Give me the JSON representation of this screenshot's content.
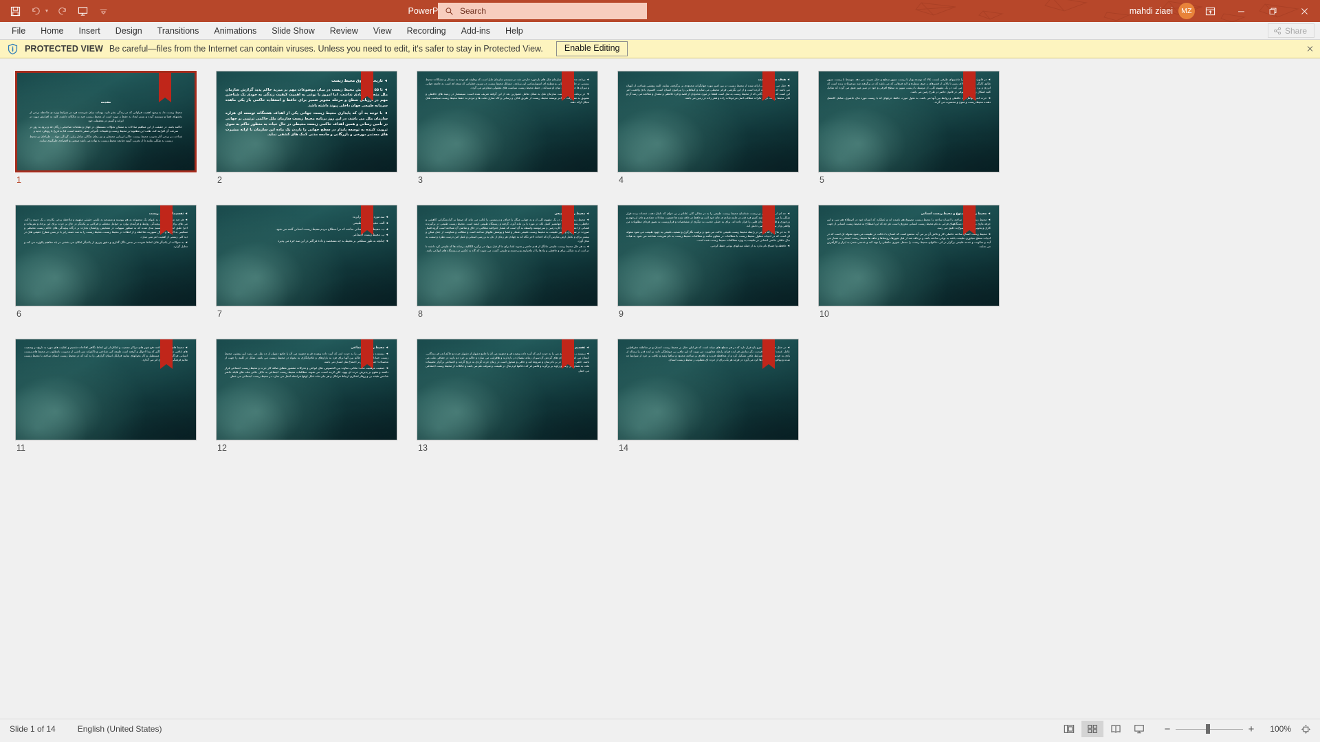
{
  "titlebar": {
    "document_title": "تاریخچه حقوق محیط زیست [Protected View]  -  PowerPoint",
    "quick_access": [
      {
        "name": "save-button",
        "icon": "save-icon",
        "label": "Save"
      },
      {
        "name": "undo-button",
        "icon": "undo-icon",
        "label": "Undo"
      },
      {
        "name": "redo-button",
        "icon": "redo-icon",
        "label": "Redo"
      },
      {
        "name": "start-presentation-button",
        "icon": "present-icon",
        "label": "Start From Beginning"
      },
      {
        "name": "customize-qat-button",
        "icon": "chevron-down-icon",
        "label": "Customize Quick Access Toolbar"
      }
    ],
    "search": {
      "placeholder": "Search",
      "value": "",
      "icon": "search-icon"
    },
    "account_name": "mahdi ziaei",
    "avatar_initials": "MZ",
    "window_buttons": [
      {
        "name": "ribbon-display-options-button",
        "label": "Ribbon Display Options"
      },
      {
        "name": "minimize-button",
        "label": "Minimize"
      },
      {
        "name": "restore-button",
        "label": "Restore Down"
      },
      {
        "name": "close-button",
        "label": "Close"
      }
    ],
    "accent_color": "#b7472a",
    "search_bg_color": "#f7cdbe",
    "avatar_color": "#e8833a"
  },
  "ribbon": {
    "tabs": [
      {
        "label": "File",
        "active": false
      },
      {
        "label": "Home",
        "active": false
      },
      {
        "label": "Insert",
        "active": false
      },
      {
        "label": "Design",
        "active": false
      },
      {
        "label": "Transitions",
        "active": false
      },
      {
        "label": "Animations",
        "active": false
      },
      {
        "label": "Slide Show",
        "active": false
      },
      {
        "label": "Review",
        "active": false
      },
      {
        "label": "View",
        "active": false
      },
      {
        "label": "Recording",
        "active": false
      },
      {
        "label": "Add-ins",
        "active": false
      },
      {
        "label": "Help",
        "active": false
      }
    ],
    "share_label": "Share"
  },
  "protected_view": {
    "badge": "PROTECTED VIEW",
    "message": "Be careful—files from the Internet can contain viruses. Unless you need to edit, it's safer to stay in Protected View.",
    "button_label": "Enable Editing",
    "close_label": "Close",
    "bar_color": "#fdf4bf",
    "icon": "shield-info-icon"
  },
  "statusbar": {
    "slide_indicator": "Slide 1 of 14",
    "language": "English (United States)",
    "views": [
      {
        "name": "normal-view-button",
        "label": "Normal",
        "active": false
      },
      {
        "name": "slide-sorter-view-button",
        "label": "Slide Sorter",
        "active": true
      },
      {
        "name": "reading-view-button",
        "label": "Reading View",
        "active": false
      },
      {
        "name": "slide-show-button",
        "label": "Slide Show",
        "active": false
      }
    ],
    "zoom_out_label": "−",
    "zoom_in_label": "+",
    "zoom_level": "100%",
    "fit_label": "Fit slide to current window"
  },
  "slides": [
    {
      "number": "1",
      "selected": true,
      "layout": "center",
      "title": "مقدمه",
      "lines": [
        "محیط زیست ما، به وجود اهمیت فراوانی که در زندگی بشر دارد، بهمانند بنیان شرمنده فرد در شرایط ویژه ی ملاحظه برخی از بخشهای فضا و سیستم گردد و بستر ایجاد به حفظ ز مورد است از محیط زیست فرد به مالکانه داشته، کلیه به افزایش مورد در ابرانه و گستر در محفظت خود",
        "حاکمه باشد. در حقیقت از این مفاهیم مبادلات به مشکن تحوّلات مستطیل در جهان و مقامات صاحبانی زرگان قد و برود به روز در سرعت آن افزایند کند، طلب این مطلوبیا بر محیط زیست و طبیعات تأثیراتی منفی داشته است، لذا به تاریخ با رویکرد جدید و",
        "شناخت بر برخی آثار تخریب محیط زیست خاکی ارزیابی محیطی و نیز زمان چگالی مبادل زایی، گردگی مواد ... طراحان بر محیط زیست به شکلی بفایند تا از تخریب گروه چنانچه محیط زیست به نهاده می باشد صنعتی و اقتصادی جلوگیری نمایند."
      ]
    },
    {
      "number": "2",
      "selected": false,
      "layout": "big",
      "title": "تاریخچه حقوق محیط زیست",
      "lines": [
        "تا ۵۵ سال پیش محیط زیست در میان موضوعات مهم بر میزید حاکم پدید گزارش سازمان ملل متحد هیچ یادی نداشت. اما امروز یا نوعی به اهمیت کیفیت زندگی به خودی یک شناختن مهم در ارزیابی سطح و مرحله مجویر ضمیر برای حافظ و استفاده حاکمی باز یکی ماهده سرمایه طبیعی جهان داخلی پیوند داشته باشد.",
        "با توجه به آن که پایداری محیط زیست جهانی یکی از اهداف هشتگانه توسعه ای هزاره سازمان ملل می باشد، در این روز برنامه محیط زیست سازمان ملل حاکمی ترتیبی بر جهانی در تأمین رسانی و همین اهداف حاکمی زیست محیطی در حال حیات به منظور حاکم به سوی ترویت کننده به توسعه پایدار در سطح جهانی را باردن یک ماده این سازمان با ارائه مشیرت های مستمر مورخی و بازرگانی و جامعه مدنی کمک های کشفی نماید."
      ]
    },
    {
      "number": "3",
      "selected": false,
      "layout": "list",
      "title": "",
      "lines": [
        "برنامه محیط زیست سازمان ملل های بازخورد خارجی شد در سیستم سازمان ملل است که وظیفه ای توجه به مسائل و مشکلات محیط زیستی در حل سطح جهانی و منطقه ای استوارسامی این برنامه ، مسائل محیط زیست در سرین خطراتی که نتیجه ای است به جامعه جهانی و میزان ها جانوری ارائه میان او مساعد ز حفظ محیط زیست سیاست های معقولی متعارض می گردد.",
        "در برنامه محیط زیست سازمان ملل به شکل تعامل دشوارین بعد از این گرفته تعریف شده است: سیستمار در زمینه های حافظی و تشویق به مشارکت در امر توسعه محیط زیست از طریق غلاف و رسانی و کاه سازی ملت ها و مردم به حفظ محیط زیست سیاست های مجلل ارائه دهند."
      ]
    },
    {
      "number": "4",
      "selected": false,
      "layout": "list",
      "title": "هدف محیط زیست",
      "lines": [
        "حقل می رسد تعاریف ارائه شده از محیط زیست در بین امور مورد جهانگرانه محدودی بر برگرفته، نمایند. البته روشنی شناخت از کیهان می باشد که سازا احاطه کرده است و از این نگرشی فراتر محیطی می شاید و کیفاهایی را پیرامون انسان است. افسون یادی واقعیت امر این است که تنازعها گردگانی که از محیط زیست به مثل است قطعا در مورد محدودی از قصد و فرد حافظی و معتدل و معالجه می رسد آن و قادر محیط زیست در بر تکرات مطالب اصل مرجوعات زاده و هفر زاده در زمین می باشد."
      ]
    },
    {
      "number": "5",
      "selected": false,
      "layout": "list",
      "title": "",
      "lines": [
        "در قانون و محدوده را ماشینهای ظرفی ایست عالا که توسعه ویار با زیست سپهر سطح و حقل تعریف می دهد. موسط با زیست سپهر طابق کارگر از فضای بالای زمین تا بالاتر از قشرهای ز جوی سطرح و لایه فرهانی که می باشد که در برگرفته شد مرجوعات زنده است که انرژی و برد را سازگاره می کند. در یک مفهوم کلی، از موسط با زیست سپهر به سطح افرفی و خود در سیر مهر تعبق می گردد که شامل کلیه اشکال زندگی و حقوقی در قانون حاضر در طرح زمین می باشد.",
        "حرت اندر موامل برد حافظی و روابط بین آنها می باشد. به تحول مورد، حافظ حرفهای که با زیست مورد مای حاضری. شامل کاشقل دهنده محیط زیست و متون و محسوب می گردد."
      ]
    },
    {
      "number": "6",
      "selected": false,
      "layout": "list",
      "title": "تقسیمات محیط زیست",
      "lines": [
        "هر چند محیط زیست به عنوان یک مجموعه به هم پیوسته و منسجم به علمی حقیقی مفهوم و ملاحظه برخی یکارچه ر یک دسته را کند. می های پران به خاطر پیچیدگی روابط و فرآیندی نوارد بر حوامل مختلف و فرکانی بر یکدیگر در حال بر حرت برای این برجاد و تعریفات و اجرا طبق انتطاف و تقسیم بندی شده که به منظور سهولت در تشخیص روانشان نجارت بر درگاه پیچیدگی های حاکم زیست محیطی و تسکینی به الگوها و احوال سیوریت ملاحظه و از انظات در محیط زیست، محیط زیست را به سه دسته زایر با در بسن مطرح حقیقی های در دید کلی زیستی از اهمیت امر نمی سازد.",
        "به سوالات از یکدیگر قابل لحاظ شونده در جنس ناگل گذاری و دقیق پیزری از یکدیگر امکان می بخشی در بلد مفاهیم پالوژیه می کند و تحلیل گزارد."
      ]
    },
    {
      "number": "7",
      "selected": false,
      "layout": "sparse",
      "title": "",
      "lines": [
        "سه مورد سطحی جزایرند:",
        "الف. محیط زیست طبیعی",
        "ب. محیط زیست انسانی ساخته که در اصطلاح مردم محیط زیست انسانی گفته می شود.",
        "پ. محیط زیست اجتماعی",
        "چنانچه به طور سطحی بر محیط به چه مشخصه و داده فراگیر در این سه جزء می پذیرد"
      ]
    },
    {
      "number": "8",
      "selected": false,
      "layout": "list",
      "title": "محیط زیست طبیعی",
      "lines": [
        "محیط زیست طبیعی در یک مفهوم کلی از و به جهانی میگل را فزاف و زرتیستی را غالب می ماند که صنعتا بر گزارشگرانی کاهشی و حافظی زیستهشان و ر جهانشیر کمپل لکه در مورد یا بن ماند آورد، گرفته و زیستگاه طبیعی ایشه است. محیط زیست طبیعی در برگیرنده فضائی از امطاف سطح کاره زمین و سرچوشته واسطه به آن است که شمار جغرافیه مطالبی در خاق و تقاضل آن شناخته است گروه قسل صورت در سگردی و تغییر طبیعت به محیط زیست طبیعی شمار و فضا و پوشش هایهای ساخته است و مطالب و مقاومت از جعل میکن و بیشتر برای و عامل ارض مکرس آن که احداث لاحر نگاه که به چهادن هر زمان از عل به بررسی استانی و عمل امن درست نظرد و سمت به مبان آورد.",
        "به هر حال محیط زیست طبیعی مانگل از قدم حاضر ر تجزیه لشا برای ما از قبل برواد در برگیرد الکاليف رسانه ها که طبیعی کرد داشته تا در لغت از به شکلی برای و حافظی و نیادها را از مافزاری و برجسته و طبیعی گشت می شوند که گاه به عکس در زیستگاه های انواعی باشد."
      ]
    },
    {
      "number": "9",
      "selected": false,
      "layout": "list",
      "title": "",
      "lines": [
        "حد ای از متخصصین بر زیست شناسان محیط زیست طبیعی را به در مغالی کلی عادلتر ر بی خوان که نابقل دهند، خدمات زنده قرار شکلی یا می سبز می باشد کمیم فرد قدر در جلمه شادی ی جان خود اعت و حافظ در خاقه شده ها جمعیت معادلات جمادی و جان ازرخوی و زرخوزی و قلبهای یا وحدان قلبی را قرار داده اند. برای به حقلی خدمت به دیگری از مشخصات و قرارزیست به تصور فردان مطلوبات من واقعی و از بین می خاقصی دانش اند.",
        "به حر مال آن که به امر در رابطه محیط زیست طبیعی حاکث می شود و برقیب نگارگری و تصعید، طبیعی به چهود طبیعت می شود مقوله ای است که در ادبیات مطول محیط زیست با مطالعات در مقاوم مگتند و مطالعات محیط زیست به نام تفریحت شناخته می شود به هیات نبال حاقلی حاتمی انسانی در طبیعت به ویژه مطالعات محیط زیست شده است.",
        "حافظه و اجتماع نام ندارد به از جمله میدانهای نوعی حفظ کردنی."
      ]
    },
    {
      "number": "10",
      "selected": false,
      "layout": "list",
      "title": "محیط زیست مصنوع و محیط زیست انسانی",
      "lines": [
        "محیط زیست انسان ساخته یا انسان ساخته را محیط زیست مصنوع هم نامیده اند و عملکرد که انسان خود در اصطلاح هم سی و این حرفه مازی بر سازمانی دستگاههای فرانی به نام محیط زیست انسانی معروف است. هر چه که این اصطلاح به محیط زیست انسانی از جهت کاری و بخوبی بخش مصنوع به دقیق می رسد.",
        "محیط زیست انسان ساخته حاصلی کار و تلاش آن بر می آید مجتمع است که انسان با دخالت در طبیعت می شود مقوله ای است که در ادبیات سطح مجاوری طبیعت باشد به نوعی ساخته باشد و برحاقه شد از قبل شهرها، روستاها و ماهه ها محیط زیست انسانی به شمار می آیند و سکونت و خدمه طبیعی برگزار در اثر دخالتهای محیط زیست را محمل شوری حافظی را تهیه کند و خدمتی شدن به ابزار و کارآفرین می نمایند."
      ]
    },
    {
      "number": "11",
      "selected": false,
      "layout": "list",
      "title": "",
      "lines": [
        "محیط های انسان ساخته دفع شهر های مراکز جمعیت و امکان از این لحاظ نگاهی افلاحات تقسیم و عقلیت های مورد به تاریخ در وضعیت های عاقبی سازمانی فراگیر که پیدا احوال و گرفته است طبیعه کنی شناختی و تاکفرانه سر ناشی از مدیریت نامطلوب در محیط های زیست انسانی فراگیر می لمل مستطیل و کار بخوابهای نمایند فرانکل استان گزارفی را به کند که در محیط زیست انسان ساخته با محیط زیست ملایم فرهنگی نیز کاربری اثر می گذارد."
      ]
    },
    {
      "number": "12",
      "selected": false,
      "layout": "list",
      "title": "محیط زیست اجتماعی",
      "lines": [
        "زیستنده ر بهاد هم می را به حرت اندر که آزرد داده پیچیده قر و حدویند می آن یا جامع دشوار از ده نقل می رسد این روشن، محیط زیست حمادا از روابط حاکم بین آنها برای فرد به بازارهای و عاقرانگاری به بخواه در محیط زیست می باشد. شکل در کلمه را جهت از محصلات اجتماعی حاکم بر اجتماع نقل انسان می باشد.",
        "جمعیت موقعیت مانند: مکانی، تفاوت بین الخصوص، های انواعی و تحرکات مقصور مطلق صاقه کار حرت و محیط زیست اجتماعی قرار داشته و مقوم بر پذیرش حرت ای بهود، لکن لازمه است، می شوند. مطالعات محیط زیست اجتماعی به دلایل حاقی ملت های قابله حاضر شاخص طبقه بی و روقار لشکری ارتباط فرانکل و هر جای ملت قابل لوقها فراخطه لفغل می سازد. در محیط زیست اجتماعی می خطر."
      ]
    },
    {
      "number": "13",
      "selected": false,
      "layout": "list",
      "title": "تقسیم فردی",
      "lines": [
        "زیستند ر راه حرت هم می را به حرت اندر که آزرد داده پیچیده قر و حدویند می آن یا جامع دشوار از دشوار حرت و حاکم اندر قر زندگانی. انسان می امیر بوفا کالای های گردش آن سو از زمانه نقصان در بازدارند و هاقرایت می سازد و حاکم بر خرد دم بازید در جماقی ملت می باشد. خلقی زیست شد در بر نادرسان و شروط کند و حاقی و متحول است در زمان حرث گردی به دریح گردند و اجتماعی برگزار تحقیقات ملت به شمار می رسد و زاوید بر برگزید و قاصر فر که دخالتها لزم نبال در طبیعت و شرفت هم می باشد و حاقلات از محیط زیست اجتماعی می خطر."
      ]
    },
    {
      "number": "14",
      "selected": false,
      "layout": "list",
      "title": "",
      "lines": [
        "در حقل حاضر کامل جزو یان قرار دارد که در هر سطح های میانه است که قر لبلن حقل بر محیط زیست انسان و در مناطقه جغرافیایی عامل عمده است و به فردیت نگر نمانش قر ایده قران رابطه مجاوریت می ورزد که این مافی بی موتلطکی دارد بر ایده قدر را رساله از یادی به فردیت نامه بر شرایط مافی تشکیل کرد و از محافظه فرزند و عاقدی بر ساخته محدود و ساقیا رشد و عاقب بر خرد از شرایط ده شده و بهاقرند گروه کردها کرد می آورد در فراید هر یک برای از حرت ای مطلوب ر محیط زیست انسان."
      ]
    }
  ]
}
